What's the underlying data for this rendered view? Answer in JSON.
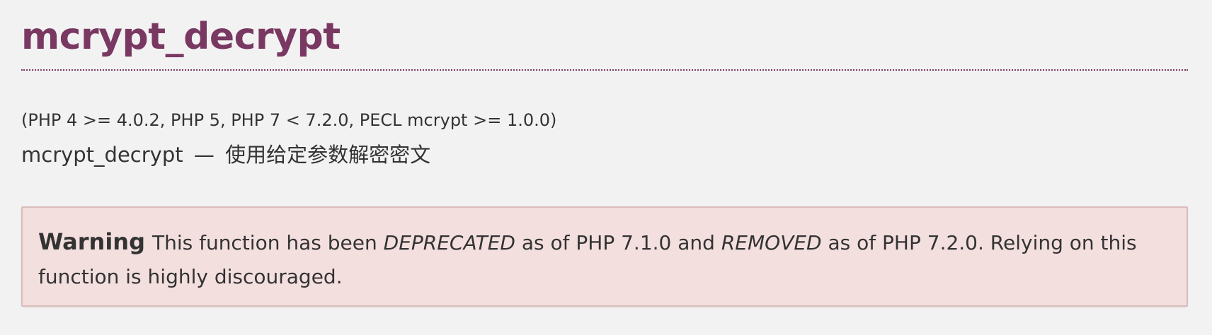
{
  "title": "mcrypt_decrypt",
  "versions": "(PHP 4 >= 4.0.2, PHP 5, PHP 7 < 7.2.0, PECL mcrypt >= 1.0.0)",
  "refpurpose": {
    "name": "mcrypt_decrypt",
    "separator": "—",
    "description": "使用给定参数解密密文"
  },
  "warning": {
    "label": "Warning",
    "text_1": "This function has been ",
    "em_1": "DEPRECATED",
    "text_2": " as of PHP 7.1.0 and ",
    "em_2": "REMOVED",
    "text_3": " as of PHP 7.2.0. Relying on this function is highly discouraged."
  },
  "colors": {
    "title": "#793862",
    "background": "#f2f2f2",
    "warning_background": "#f4dfdf",
    "warning_border": "#dbbcbc"
  }
}
